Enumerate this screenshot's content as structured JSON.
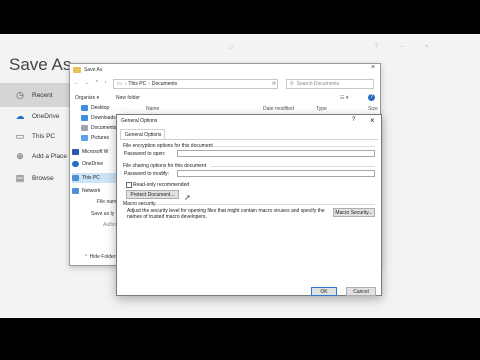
{
  "backstage": {
    "title": "Save As",
    "nav": [
      {
        "label": "Recent",
        "icon": "clock-icon"
      },
      {
        "label": "OneDrive",
        "icon": "cloud-icon"
      },
      {
        "label": "This PC",
        "icon": "computer-icon"
      },
      {
        "label": "Add a Place",
        "icon": "globe-icon"
      },
      {
        "label": "Browse",
        "icon": "folder-icon"
      }
    ]
  },
  "save_dialog": {
    "title": "Save As",
    "breadcrumb": [
      "This PC",
      "Documents"
    ],
    "search_placeholder": "Search Documents",
    "organize": "Organize ▾",
    "new_folder": "New folder",
    "columns": {
      "name": "Name",
      "date": "Date modified",
      "type": "Type",
      "size": "Size"
    },
    "tree": [
      "Desktop",
      "Downloads",
      "Documents",
      "Pictures",
      "Microsoft W",
      "OneDrive",
      "This PC",
      "Network"
    ],
    "file_name_label": "File nam",
    "save_type_label": "Save as ty",
    "authors_label": "Autho",
    "hide_folders": "Hide Folders"
  },
  "general_options": {
    "title": "General Options",
    "help": "?",
    "close": "×",
    "tab": "General Options",
    "encrypt_section": "File encryption options for this document",
    "password_open_label": "Password to open:",
    "sharing_section": "File sharing options for this document",
    "password_modify_label": "Password to modify:",
    "read_only_label": "Read-only recommended",
    "protect_button": "Protect Document...",
    "macro_section": "Macro security",
    "macro_text": "Adjust the security level for opening files that might contain macro viruses and specify the names of trusted macro developers.",
    "macro_button": "Macro Security...",
    "ok": "OK",
    "cancel": "Cancel"
  }
}
